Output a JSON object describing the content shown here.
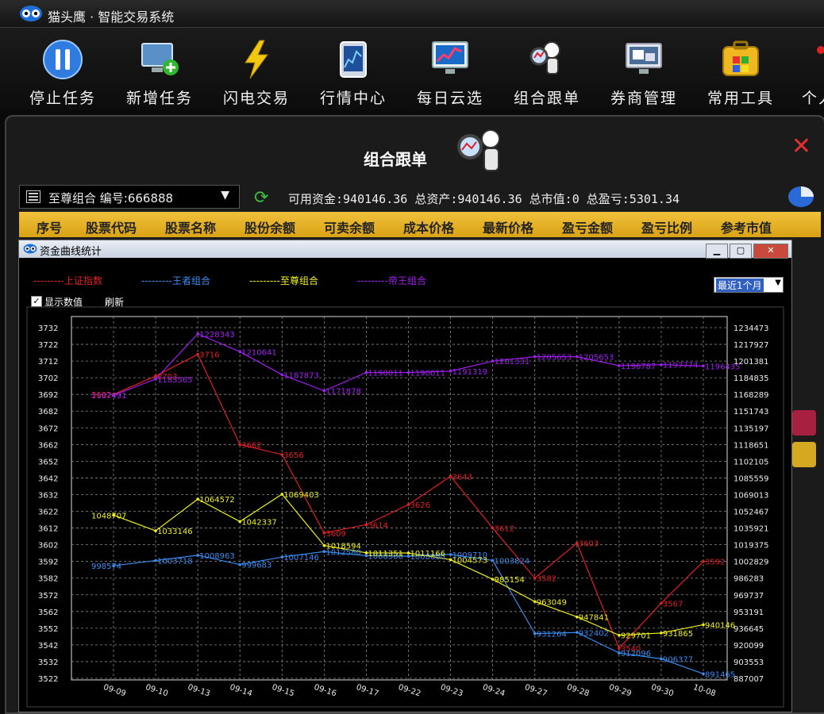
{
  "app": {
    "title": "猫头鹰 · 智能交易系统"
  },
  "toolbar": {
    "items": [
      {
        "label": "停止任务",
        "icon": "pause-icon"
      },
      {
        "label": "新增任务",
        "icon": "monitor-add-icon"
      },
      {
        "label": "闪电交易",
        "icon": "lightning-icon"
      },
      {
        "label": "行情中心",
        "icon": "chart-tablet-icon"
      },
      {
        "label": "每日云选",
        "icon": "trend-monitor-icon"
      },
      {
        "label": "组合跟单",
        "icon": "owl-magnifier-icon"
      },
      {
        "label": "券商管理",
        "icon": "screen-windows-icon"
      },
      {
        "label": "常用工具",
        "icon": "toolbox-icon"
      },
      {
        "label": "个人",
        "icon": "person-icon"
      }
    ]
  },
  "panel": {
    "title": "组合跟单",
    "combo_value": "至尊组合  编号:666888",
    "account": "可用资金:940146.36 总资产:940146.36 总市值:0 总盈亏:5301.34",
    "columns": [
      "序号",
      "股票代码",
      "股票名称",
      "股份余额",
      "可卖余额",
      "成本价格",
      "最新价格",
      "盈亏金额",
      "盈亏比例",
      "参考市值"
    ]
  },
  "window": {
    "title": "资金曲线统计",
    "show_values_label": "显示数值",
    "refresh_label": "刷新",
    "period": "最近1个月",
    "legend": [
      {
        "text": "---------上证指数",
        "color": "#e02020"
      },
      {
        "text": "---------王者组合",
        "color": "#3c8cf0"
      },
      {
        "text": "---------至尊组合",
        "color": "#f0f020"
      },
      {
        "text": "---------帝王组合",
        "color": "#a020f0"
      }
    ]
  },
  "chart_data": {
    "type": "line",
    "x": [
      "09-09",
      "09-10",
      "09-13",
      "09-14",
      "09-15",
      "09-16",
      "09-17",
      "09-22",
      "09-23",
      "09-24",
      "09-27",
      "09-28",
      "09-29",
      "09-30",
      "10-08"
    ],
    "y_left_ticks": [
      "3732",
      "3722",
      "3712",
      "3702",
      "3692",
      "3682",
      "3672",
      "3662",
      "3652",
      "3642",
      "3632",
      "3622",
      "3612",
      "3602",
      "3592",
      "3582",
      "3572",
      "3562",
      "3552",
      "3542",
      "3532",
      "3522"
    ],
    "y_right_ticks": [
      "1234473",
      "1217927",
      "1201381",
      "1184835",
      "1168289",
      "1151743",
      "1135197",
      "1118651",
      "1102105",
      "1085559",
      "1069013",
      "1052467",
      "1035921",
      "1019375",
      "1002829",
      "986283",
      "969737",
      "953191",
      "936645",
      "920099",
      "903553",
      "887007"
    ],
    "series": [
      {
        "name": "上证指数",
        "color": "#e02020",
        "axis": "left",
        "values": [
          3692,
          3703,
          3716,
          3662,
          3656,
          3609,
          3614,
          3626,
          3643,
          3612,
          3582,
          3603,
          3540,
          3567,
          3592
        ]
      },
      {
        "name": "王者组合",
        "color": "#3c8cf0",
        "axis": "right",
        "values": [
          998574,
          1003718,
          1008963,
          999683,
          1007146,
          1012580,
          1008500,
          1008000,
          1009710,
          1003824,
          931264,
          932402,
          912096,
          906377,
          891465
        ]
      },
      {
        "name": "至尊组合",
        "color": "#f0f020",
        "axis": "right",
        "values": [
          1048707,
          1033146,
          1064572,
          1042337,
          1069403,
          1018594,
          1011351,
          1011166,
          1004573,
          985154,
          963049,
          947841,
          929701,
          931865,
          940146
        ]
      },
      {
        "name": "帝王组合",
        "color": "#a020f0",
        "axis": "right",
        "values": [
          1167491,
          1183565,
          1228343,
          1210641,
          1187873,
          1171878,
          1190011,
          1190011,
          1191319,
          1201331,
          1205653,
          1205653,
          1196787,
          1197774,
          1196435
        ]
      }
    ]
  }
}
